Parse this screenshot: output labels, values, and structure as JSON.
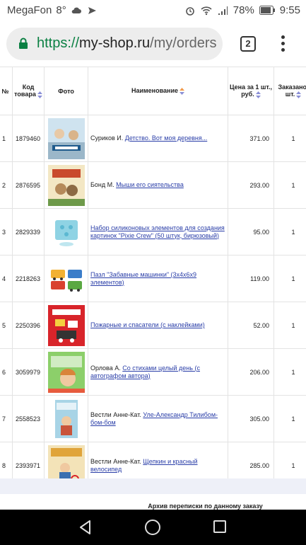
{
  "status_bar": {
    "carrier": "MegaFon",
    "temperature": "8°",
    "battery": "78%",
    "time": "9:55"
  },
  "browser": {
    "url_scheme": "https://",
    "url_host": "my-shop.ru",
    "url_path": "/my/orders",
    "tab_count": "2"
  },
  "table": {
    "headers": {
      "num": "№",
      "code": "Код товара",
      "photo": "Фото",
      "name": "Наименование",
      "price": "Цена за 1 шт., руб.",
      "qty": "Заказано, шт."
    },
    "rows": [
      {
        "num": "1",
        "code": "1879460",
        "author": "Суриков И. ",
        "title": "Детство. Вот моя деревня...",
        "price": "371.00",
        "qty": "1"
      },
      {
        "num": "2",
        "code": "2876595",
        "author": "Бонд М. ",
        "title": "Мыши его сиятельства",
        "price": "293.00",
        "qty": "1"
      },
      {
        "num": "3",
        "code": "2829339",
        "author": "",
        "title": "Набор силиконовых элементов для создания картинок \"Pixie Crew\" (50 штук, бирюзовый)",
        "price": "95.00",
        "qty": "1"
      },
      {
        "num": "4",
        "code": "2218263",
        "author": "",
        "title": "Пазл \"Забавные машинки\" (3х4х6х9 элементов)",
        "price": "119.00",
        "qty": "1"
      },
      {
        "num": "5",
        "code": "2250396",
        "author": "",
        "title": "Пожарные и спасатели (с наклейками)",
        "price": "52.00",
        "qty": "1"
      },
      {
        "num": "6",
        "code": "3059979",
        "author": "Орлова А. ",
        "title": "Со стихами целый день (с автографом автора)",
        "price": "206.00",
        "qty": "1"
      },
      {
        "num": "7",
        "code": "2558523",
        "author": "Вестли Анне-Кат. ",
        "title": "Уле-Александр Тилибом-бом-бом",
        "price": "305.00",
        "qty": "1"
      },
      {
        "num": "8",
        "code": "2393971",
        "author": "Вестли Анне-Кат. ",
        "title": "Щепкин и красный велосипед",
        "price": "285.00",
        "qty": "1"
      }
    ]
  },
  "archive_text": "Архив переписки по данному заказу",
  "colors": {
    "link": "#2a3ea8",
    "url_scheme": "#0b8043",
    "sort_up": "#f29a4a",
    "sort_down": "#8a8fd6"
  }
}
